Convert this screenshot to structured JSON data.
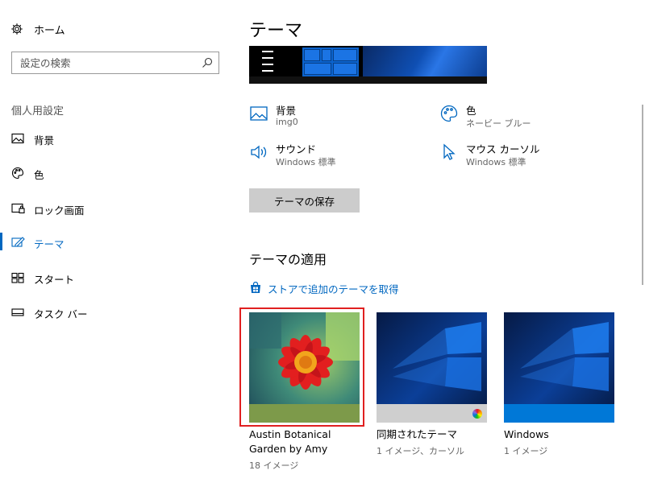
{
  "sidebar": {
    "home_label": "ホーム",
    "search_placeholder": "設定の検索",
    "section_title": "個人用設定",
    "items": [
      {
        "label": "背景",
        "icon": "picture-icon"
      },
      {
        "label": "色",
        "icon": "palette-icon"
      },
      {
        "label": "ロック画面",
        "icon": "lock-screen-icon"
      },
      {
        "label": "テーマ",
        "icon": "theme-icon",
        "active": true
      },
      {
        "label": "スタート",
        "icon": "start-icon"
      },
      {
        "label": "タスク バー",
        "icon": "taskbar-icon"
      }
    ]
  },
  "main": {
    "title": "テーマ",
    "attributes": {
      "background": {
        "title": "背景",
        "value": "img0"
      },
      "color": {
        "title": "色",
        "value": "ネービー ブルー"
      },
      "sound": {
        "title": "サウンド",
        "value": "Windows 標準"
      },
      "cursor": {
        "title": "マウス カーソル",
        "value": "Windows 標準"
      }
    },
    "save_button": "テーマの保存",
    "apply_title": "テーマの適用",
    "store_link": "ストアで追加のテーマを取得",
    "themes": [
      {
        "name": "Austin Botanical Garden by Amy",
        "meta": "18 イメージ",
        "selected": true
      },
      {
        "name": "同期されたテーマ",
        "meta": "1 イメージ、カーソル"
      },
      {
        "name": "Windows",
        "meta": "1 イメージ"
      }
    ]
  },
  "colors": {
    "accent": "#0067c0",
    "selection": "#e02020",
    "button_bg": "#cccccc",
    "austin_bar": "#7d9a4a",
    "windows_bar": "#0078d7",
    "synced_bar": "#cfcfcf"
  }
}
